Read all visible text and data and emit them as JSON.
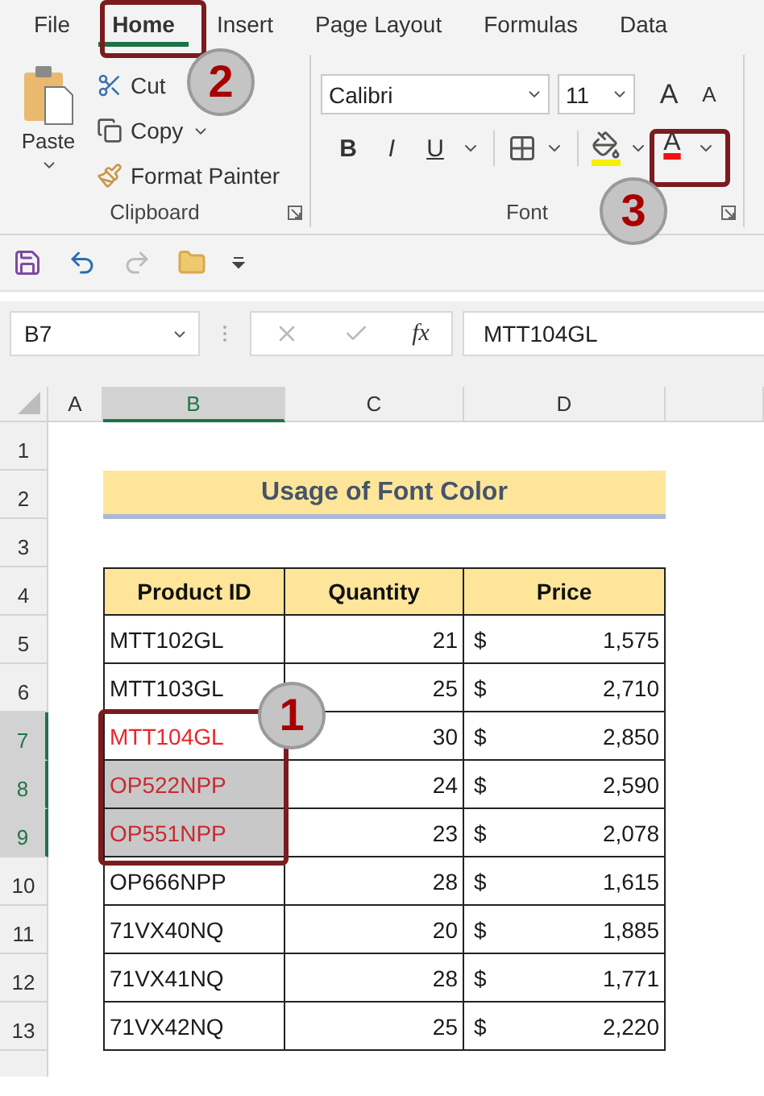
{
  "tabs": [
    {
      "label": "File",
      "selected": false
    },
    {
      "label": "Home",
      "selected": true
    },
    {
      "label": "Insert",
      "selected": false
    },
    {
      "label": "Page Layout",
      "selected": false
    },
    {
      "label": "Formulas",
      "selected": false
    },
    {
      "label": "Data",
      "selected": false
    }
  ],
  "clipboard": {
    "paste": "Paste",
    "cut": "Cut",
    "copy": "Copy",
    "format_painter": "Format Painter",
    "group_label": "Clipboard"
  },
  "font": {
    "name": "Calibri",
    "size": "11",
    "grow": "A",
    "shrink": "A",
    "bold": "B",
    "italic": "I",
    "underline": "U",
    "font_color_letter": "A",
    "group_label": "Font"
  },
  "formula_bar": {
    "name_box": "B7",
    "function_label": "fx",
    "value": "MTT104GL"
  },
  "sheet": {
    "columns": [
      {
        "letter": "A",
        "selected": false
      },
      {
        "letter": "B",
        "selected": true
      },
      {
        "letter": "C",
        "selected": false
      },
      {
        "letter": "D",
        "selected": false
      }
    ],
    "row_numbers": [
      {
        "label": "1",
        "selected": false
      },
      {
        "label": "2",
        "selected": false
      },
      {
        "label": "3",
        "selected": false
      },
      {
        "label": "4",
        "selected": false
      },
      {
        "label": "5",
        "selected": false
      },
      {
        "label": "6",
        "selected": false
      },
      {
        "label": "7",
        "selected": true
      },
      {
        "label": "8",
        "selected": true
      },
      {
        "label": "9",
        "selected": true
      },
      {
        "label": "10",
        "selected": false
      },
      {
        "label": "11",
        "selected": false
      },
      {
        "label": "12",
        "selected": false
      },
      {
        "label": "13",
        "selected": false
      }
    ],
    "title": "Usage of Font Color",
    "table": {
      "headers": [
        "Product ID",
        "Quantity",
        "Price"
      ],
      "rows": [
        {
          "product_id": "MTT102GL",
          "quantity": "21",
          "currency": "$",
          "price": "1,575",
          "color": "#1a1a1a",
          "selected": false
        },
        {
          "product_id": "MTT103GL",
          "quantity": "25",
          "currency": "$",
          "price": "2,710",
          "color": "#1a1a1a",
          "selected": false
        },
        {
          "product_id": "MTT104GL",
          "quantity": "30",
          "currency": "$",
          "price": "2,850",
          "color": "#e8262b",
          "selected": false
        },
        {
          "product_id": "OP522NPP",
          "quantity": "24",
          "currency": "$",
          "price": "2,590",
          "color": "#c62a30",
          "selected": true
        },
        {
          "product_id": "OP551NPP",
          "quantity": "23",
          "currency": "$",
          "price": "2,078",
          "color": "#c62a30",
          "selected": true
        },
        {
          "product_id": "OP666NPP",
          "quantity": "28",
          "currency": "$",
          "price": "1,615",
          "color": "#1a1a1a",
          "selected": false
        },
        {
          "product_id": "71VX40NQ",
          "quantity": "20",
          "currency": "$",
          "price": "1,885",
          "color": "#1a1a1a",
          "selected": false
        },
        {
          "product_id": "71VX41NQ",
          "quantity": "28",
          "currency": "$",
          "price": "1,771",
          "color": "#1a1a1a",
          "selected": false
        },
        {
          "product_id": "71VX42NQ",
          "quantity": "25",
          "currency": "$",
          "price": "2,220",
          "color": "#1a1a1a",
          "selected": false
        }
      ]
    }
  },
  "annotations": [
    {
      "number": "2",
      "kind": "tab"
    },
    {
      "number": "3",
      "kind": "font-color"
    },
    {
      "number": "1",
      "kind": "range"
    }
  ]
}
